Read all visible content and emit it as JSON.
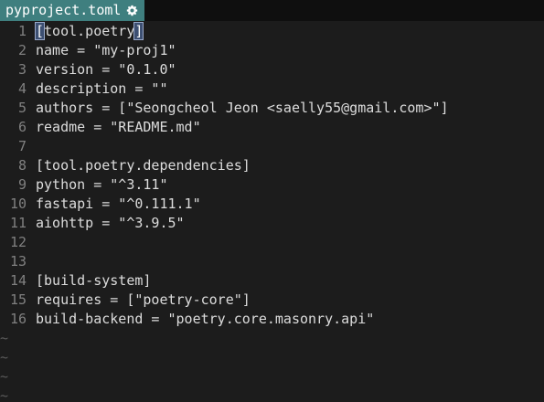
{
  "tab": {
    "filename": "pyproject.toml",
    "icon": "gear-icon"
  },
  "lines": [
    {
      "num": "1",
      "cursor_char": "[",
      "text": "tool.poetry",
      "close": "]"
    },
    {
      "num": "2",
      "text": "name = \"my-proj1\""
    },
    {
      "num": "3",
      "text": "version = \"0.1.0\""
    },
    {
      "num": "4",
      "text": "description = \"\""
    },
    {
      "num": "5",
      "text": "authors = [\"Seongcheol Jeon <saelly55@gmail.com>\"]"
    },
    {
      "num": "6",
      "text": "readme = \"README.md\""
    },
    {
      "num": "7",
      "text": ""
    },
    {
      "num": "8",
      "text": "[tool.poetry.dependencies]"
    },
    {
      "num": "9",
      "text": "python = \"^3.11\""
    },
    {
      "num": "10",
      "text": "fastapi = \"^0.111.1\""
    },
    {
      "num": "11",
      "text": "aiohttp = \"^3.9.5\""
    },
    {
      "num": "12",
      "text": ""
    },
    {
      "num": "13",
      "text": ""
    },
    {
      "num": "14",
      "text": "[build-system]"
    },
    {
      "num": "15",
      "text": "requires = [\"poetry-core\"]"
    },
    {
      "num": "16",
      "text": "build-backend = \"poetry.core.masonry.api\""
    }
  ],
  "empty_marker": "~",
  "colors": {
    "tab_bg": "#3f7f7f",
    "editor_bg": "#1c1c1c",
    "line_number": "#808080",
    "text": "#dcdcdc"
  }
}
